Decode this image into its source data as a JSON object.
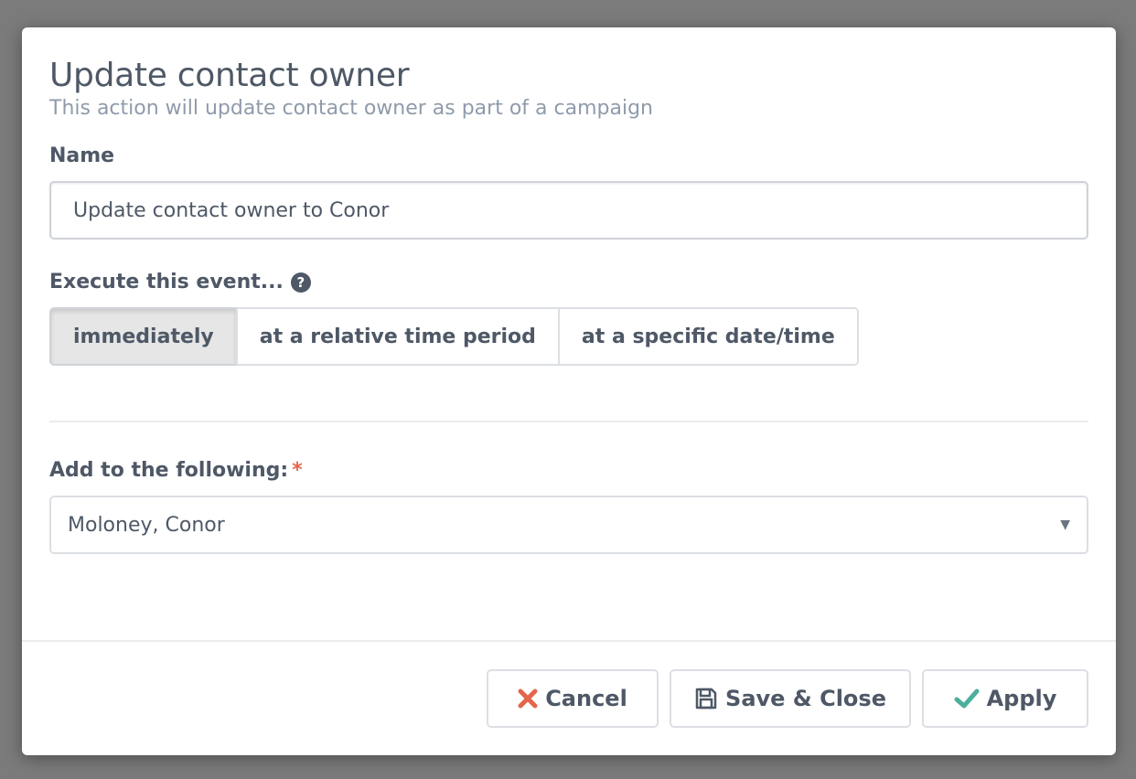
{
  "modal": {
    "title": "Update contact owner",
    "subtitle": "This action will update contact owner as part of a campaign"
  },
  "name_field": {
    "label": "Name",
    "value": "Update contact owner to Conor"
  },
  "execute": {
    "label": "Execute this event...",
    "help_icon": "question-circle-icon",
    "options": [
      "immediately",
      "at a relative time period",
      "at a specific date/time"
    ],
    "selected": "immediately"
  },
  "owner": {
    "label": "Add to the following:",
    "required_mark": "*",
    "selected_value": "Moloney, Conor"
  },
  "footer": {
    "cancel_label": "Cancel",
    "save_label": "Save & Close",
    "apply_label": "Apply"
  },
  "colors": {
    "cancel_icon": "#e4654b",
    "apply_icon": "#4cae9b",
    "text": "#4e5866",
    "subtitle": "#8f9bab"
  }
}
